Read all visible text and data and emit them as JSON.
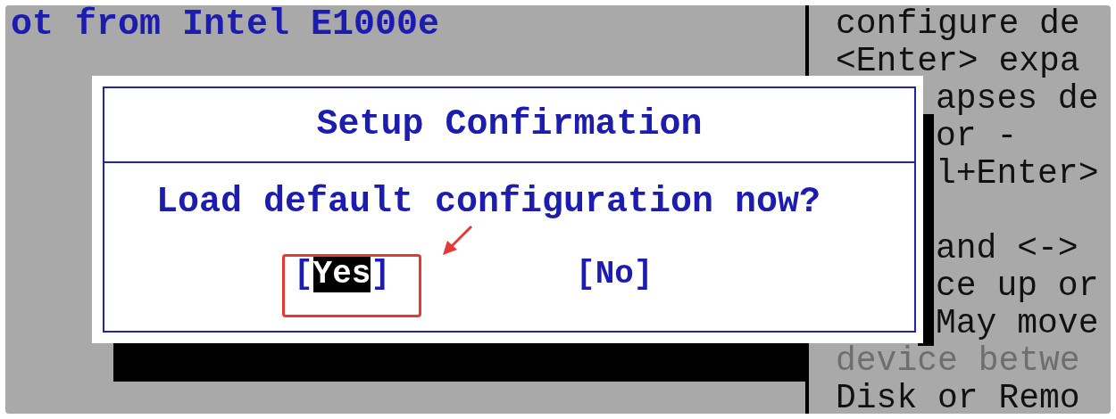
{
  "background_text": "ot from Intel E1000e",
  "help_lines": [
    {
      "text": "configure de",
      "kind": "full",
      "disabled": false
    },
    {
      "text": "<Enter> expa",
      "kind": "full",
      "disabled": false
    },
    {
      "text": "apses de",
      "kind": "clipped",
      "disabled": false
    },
    {
      "text": "or -",
      "kind": "clipped",
      "disabled": false
    },
    {
      "text": "l+Enter>",
      "kind": "clipped",
      "disabled": false
    },
    {
      "text": "and <->",
      "kind": "clipped-spaced",
      "disabled": false
    },
    {
      "text": "ce up or",
      "kind": "clipped",
      "disabled": false
    },
    {
      "text": "May move",
      "kind": "clipped",
      "disabled": false
    },
    {
      "text": "device betwe",
      "kind": "full",
      "disabled": true
    },
    {
      "text": "Disk or Remo",
      "kind": "full",
      "disabled": false
    }
  ],
  "dialog": {
    "title": "Setup Confirmation",
    "message": "Load default configuration now?",
    "options": [
      {
        "open": "[",
        "label": "Yes",
        "close": "]",
        "selected": true
      },
      {
        "open": "[",
        "label": "No",
        "close": "]",
        "selected": false
      }
    ]
  }
}
